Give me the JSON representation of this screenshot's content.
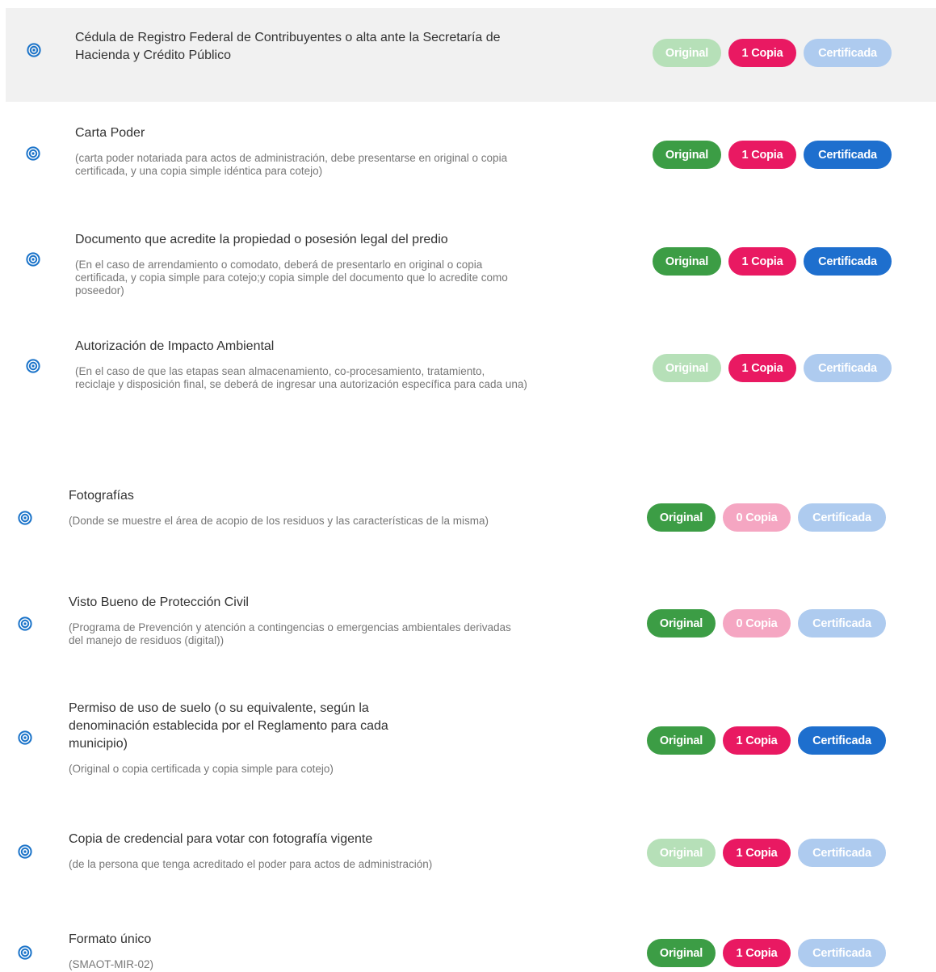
{
  "documents": [
    {
      "title": "Cédula de Registro Federal de Contribuyentes o alta ante la Secretaría de Hacienda y Crédito Público",
      "description": "",
      "badges": {
        "original": "Original",
        "copia": "1 Copia",
        "certificada": "Certificada"
      },
      "status": {
        "original": "inactive",
        "copia": "active",
        "certificada": "inactive"
      }
    },
    {
      "title": "Carta Poder",
      "description": "(carta poder notariada para actos de administración, debe presentarse en original o copia certificada, y una copia simple idéntica para cotejo)",
      "badges": {
        "original": "Original",
        "copia": "1 Copia",
        "certificada": "Certificada"
      },
      "status": {
        "original": "active",
        "copia": "active",
        "certificada": "active"
      }
    },
    {
      "title": "Documento que acredite la propiedad o posesión legal del predio",
      "description": "(En el caso de arrendamiento o comodato, deberá de presentarlo en original o copia certificada, y copia simple para cotejo;y copia simple del documento que lo acredite como poseedor)",
      "badges": {
        "original": "Original",
        "copia": "1 Copia",
        "certificada": "Certificada"
      },
      "status": {
        "original": "active",
        "copia": "active",
        "certificada": "active"
      }
    },
    {
      "title": "Autorización de Impacto Ambiental",
      "description": "(En el caso de que las etapas sean almacenamiento, co-procesamiento, tratamiento, reciclaje y disposición final, se deberá de ingresar una autorización específica para cada una)",
      "badges": {
        "original": "Original",
        "copia": "1 Copia",
        "certificada": "Certificada"
      },
      "status": {
        "original": "inactive",
        "copia": "active",
        "certificada": "inactive"
      }
    },
    {
      "title": "Fotografías",
      "description": "(Donde se muestre el área de acopio de los residuos y las características de la misma)",
      "badges": {
        "original": "Original",
        "copia": "0 Copia",
        "certificada": "Certificada"
      },
      "status": {
        "original": "active",
        "copia": "inactive",
        "certificada": "inactive"
      }
    },
    {
      "title": "Visto Bueno de Protección Civil",
      "description": "(Programa de Prevención y atención a contingencias o emergencias ambientales derivadas del manejo de residuos (digital))",
      "badges": {
        "original": "Original",
        "copia": "0 Copia",
        "certificada": "Certificada"
      },
      "status": {
        "original": "active",
        "copia": "inactive",
        "certificada": "inactive"
      }
    },
    {
      "title": "Permiso de uso de suelo (o su equivalente, según la denominación establecida por el Reglamento para cada municipio)",
      "description": "(Original o copia certificada y copia simple para cotejo)",
      "badges": {
        "original": "Original",
        "copia": "1 Copia",
        "certificada": "Certificada"
      },
      "status": {
        "original": "active",
        "copia": "active",
        "certificada": "active"
      }
    },
    {
      "title": "Copia de credencial para votar con fotografía vigente",
      "description": "(de la persona que tenga acreditado el poder para actos de administración)",
      "badges": {
        "original": "Original",
        "copia": "1 Copia",
        "certificada": "Certificada"
      },
      "status": {
        "original": "inactive",
        "copia": "active",
        "certificada": "inactive"
      }
    },
    {
      "title": "Formato único",
      "description": "(SMAOT-MIR-02)",
      "badges": {
        "original": "Original",
        "copia": "1 Copia",
        "certificada": "Certificada"
      },
      "status": {
        "original": "active",
        "copia": "active",
        "certificada": "inactive"
      }
    }
  ],
  "colors": {
    "original_active": "#3c9d45",
    "original_inactive": "#b6e0b8",
    "copia_active": "#e91962",
    "copia_inactive": "#f5a6c2",
    "certificada_active": "#1e6fce",
    "certificada_inactive": "#aecbef",
    "icon": "#1a73c9"
  }
}
